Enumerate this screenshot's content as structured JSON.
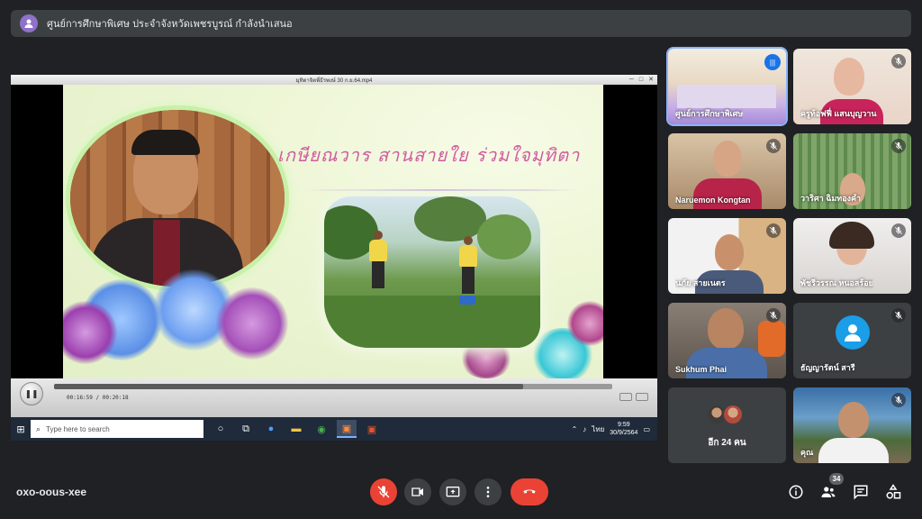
{
  "banner": {
    "text": "ศูนย์การศึกษาพิเศษ ประจำจังหวัดเพชรบูรณ์ กำลังนำเสนอ",
    "icon": "person-icon"
  },
  "player": {
    "title": "มุทิตาจิตพี่ธีรพงษ์ 30 ก.ย.64.mp4",
    "time_text": "00:16:59 / 00:20:18",
    "progress": 0.84
  },
  "slide": {
    "title": "เกษียณวาร สานสายใย ร่วมใจมุทิตา"
  },
  "taskbar": {
    "search_placeholder": "Type here to search",
    "language": "ไทย",
    "time": "9:59",
    "date": "30/9/2564"
  },
  "participants": [
    {
      "name": "ศูนย์การศึกษาพิเศษ",
      "status": "speaking"
    },
    {
      "name": "ครูท้อฟฟี่ แสนบุญวาน",
      "status": "muted"
    },
    {
      "name": "Naruemon Kongtan",
      "status": "muted"
    },
    {
      "name": "วาริศา ฉิมทองคำ",
      "status": "muted"
    },
    {
      "name": "นภัย สายเนตร",
      "status": "muted"
    },
    {
      "name": "พัชรีวรรณ หนอสร้อย",
      "status": "muted"
    },
    {
      "name": "Sukhum Phai",
      "status": "muted"
    },
    {
      "name": "ธัญญารัตน์ สารี",
      "status": "muted"
    },
    {
      "name": "คุณ",
      "status": "muted"
    }
  ],
  "more_tile": {
    "label": "อีก 24 คน"
  },
  "bottom_bar": {
    "meeting_code": "oxo-oous-xee",
    "people_count": "34"
  },
  "colors": {
    "background": "#202124",
    "danger": "#ea4335",
    "speaking_border": "#8ab4f8"
  }
}
